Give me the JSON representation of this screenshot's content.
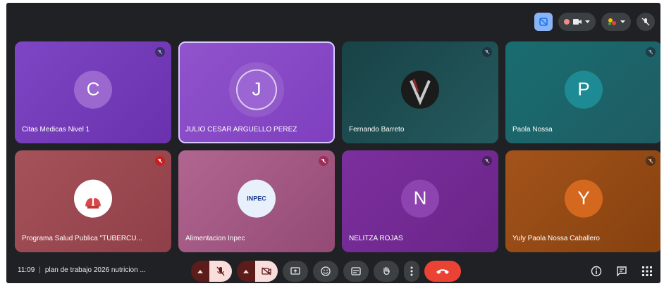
{
  "meeting": {
    "time": "11:09",
    "title": "plan de trabajo 2026 nutricion ..."
  },
  "participants": [
    {
      "name": "Citas Medicas Nivel 1",
      "initial": "C",
      "bg": "#7a3fbd",
      "avatar_bg": "#9a68cf",
      "mic": "muted"
    },
    {
      "name": "JULIO CESAR ARGUELLO PEREZ",
      "initial": "J",
      "bg": "#8748c6",
      "avatar_bg": "#9b66d4",
      "mic": "none",
      "selected": true
    },
    {
      "name": "Fernando Barreto",
      "initial": "",
      "bg": "#1c4c50",
      "avatar_bg": "#2a2a2a",
      "mic": "muted",
      "photo": true
    },
    {
      "name": "Paola Nossa",
      "initial": "P",
      "bg": "#1a6d72",
      "avatar_bg": "#1e8b94",
      "mic": "muted"
    },
    {
      "name": "Programa Salud Publica \"TUBERCU...",
      "initial": "",
      "bg": "#a24a52",
      "avatar_bg": "#ffffff",
      "mic": "muted-red",
      "logo": "lungs"
    },
    {
      "name": "Alimentacion Inpec",
      "initial": "",
      "bg": "#a85a82",
      "avatar_bg": "#e8f1fb",
      "mic": "muted",
      "logo": "inpec",
      "logo_text": "INPEC"
    },
    {
      "name": "NELITZA ROJAS",
      "initial": "N",
      "bg": "#7a2f9a",
      "avatar_bg": "#8e44b0",
      "mic": "muted"
    },
    {
      "name": "Yuly Paola Nossa Caballero",
      "initial": "Y",
      "bg": "#9a4a14",
      "avatar_bg": "#c7601a",
      "mic": "muted"
    }
  ],
  "icons": {
    "layout": "tile-layout-icon",
    "record": "record-icon",
    "reactions": "reactions-icon",
    "hand": "raise-hand-icon",
    "hangup": "hangup-icon",
    "info": "info-icon",
    "chat": "chat-icon",
    "activities": "activities-icon"
  }
}
